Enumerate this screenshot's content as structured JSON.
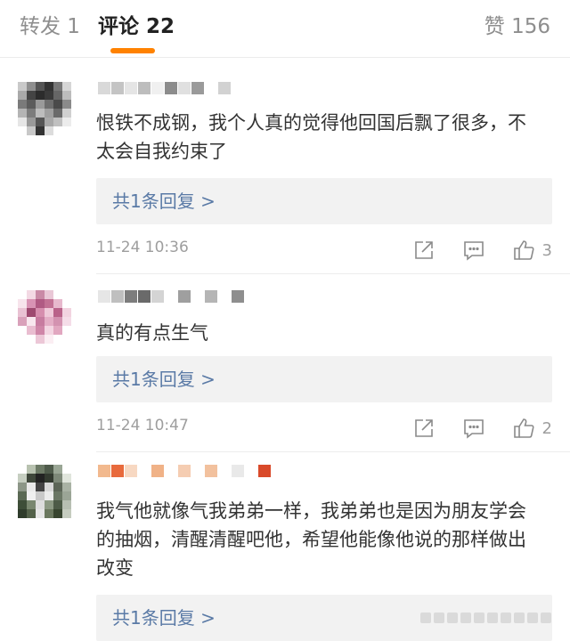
{
  "tabs": {
    "repost": "转发 1",
    "comments": "评论 22",
    "likes": "赞 156"
  },
  "colors": {
    "accent": "#ff8200",
    "link": "#5a7aa6",
    "muted": "#9e9e9e"
  },
  "icons": [
    "share-icon",
    "comment-icon",
    "like-icon"
  ],
  "comments": [
    {
      "text": "恨铁不成钢，我个人真的觉得他回国后飘了很多，不太会自我约束了",
      "replies": "共1条回复 >",
      "time": "11-24 10:36",
      "likes": "3"
    },
    {
      "text": "真的有点生气",
      "replies": "共1条回复 >",
      "time": "11-24 10:47",
      "likes": "2"
    },
    {
      "text": "我气他就像气我弟弟一样，我弟弟也是因为朋友学会的抽烟，清醒清醒吧他，希望他能像他说的那样做出改变",
      "replies": "共1条回复 >"
    }
  ]
}
